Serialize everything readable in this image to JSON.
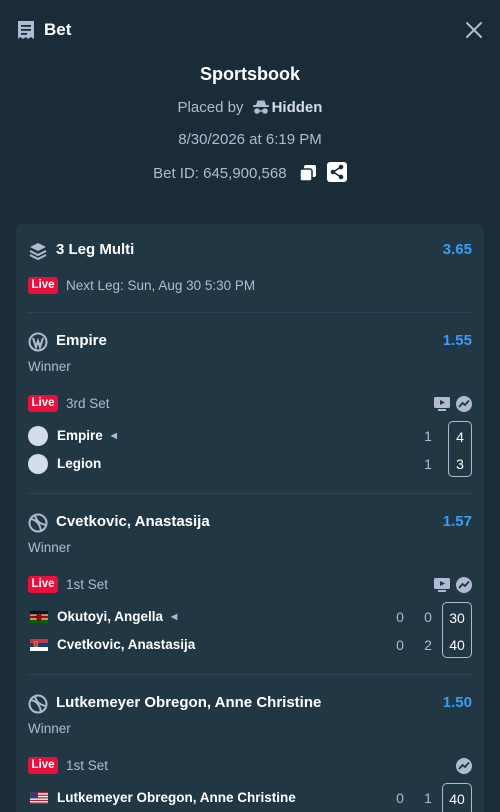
{
  "header": {
    "title": "Bet",
    "icon": "receipt-icon",
    "close_icon": "close-icon"
  },
  "meta": {
    "title": "Sportsbook",
    "placed_by_label": "Placed by",
    "placed_by_user": "Hidden",
    "datetime": "8/30/2026 at 6:19 PM",
    "bet_id_label": "Bet ID: 645,900,568"
  },
  "multi": {
    "title": "3 Leg Multi",
    "odds": "3.65",
    "live_badge": "Live",
    "next_leg": "Next Leg: Sun, Aug 30 5:30 PM"
  },
  "legs": [
    {
      "title": "Empire",
      "odds": "1.55",
      "market": "Winner",
      "live_badge": "Live",
      "status": "3rd Set",
      "teams": [
        {
          "name": "Empire",
          "s1": "1",
          "s2": "",
          "box": "4"
        },
        {
          "name": "Legion",
          "s1": "1",
          "s2": "",
          "box": "3"
        }
      ]
    },
    {
      "title": "Cvetkovic, Anastasija",
      "odds": "1.57",
      "market": "Winner",
      "live_badge": "Live",
      "status": "1st Set",
      "teams": [
        {
          "name": "Okutoyi, Angella",
          "s1": "0",
          "s2": "0",
          "box": "30"
        },
        {
          "name": "Cvetkovic, Anastasija",
          "s1": "0",
          "s2": "2",
          "box": "40"
        }
      ]
    },
    {
      "title": "Lutkemeyer Obregon, Anne Christine",
      "odds": "1.50",
      "market": "Winner",
      "live_badge": "Live",
      "status": "1st Set",
      "teams": [
        {
          "name": "Lutkemeyer Obregon, Anne Christine",
          "s1": "0",
          "s2": "1",
          "box": "40"
        }
      ]
    }
  ],
  "colors": {
    "background": "#1a2c38",
    "card": "#213743",
    "odds": "#3a9df6",
    "live": "#e9113c"
  }
}
